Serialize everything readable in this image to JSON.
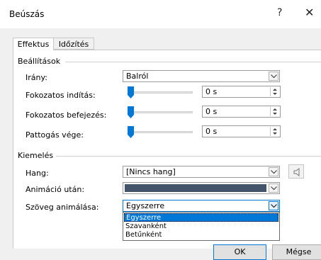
{
  "dialog": {
    "title": "Beúszás",
    "help_glyph": "?",
    "close_glyph": "✕"
  },
  "tabs": [
    {
      "label": "Effektus",
      "active": true
    },
    {
      "label": "Időzítés",
      "active": false
    }
  ],
  "settings": {
    "group_label": "Beállítások",
    "direction_label": "Irány:",
    "direction_value": "Balról",
    "smooth_start_label": "Fokozatos indítás:",
    "smooth_start_value": "0 s",
    "smooth_end_label": "Fokozatos befejezés:",
    "smooth_end_value": "0 s",
    "bounce_end_label": "Pattogás vége:",
    "bounce_end_value": "0 s",
    "slider_levels": [
      0,
      0,
      0
    ]
  },
  "enhancements": {
    "group_label": "Kiemelés",
    "sound_label": "Hang:",
    "sound_value": "[Nincs hang]",
    "after_animation_label": "Animáció után:",
    "after_animation_color": "#44546a",
    "animate_text_label": "Szöveg animálása:",
    "animate_text_value": "Egyszerre",
    "animate_text_options": [
      "Egyszerre",
      "Szavanként",
      "Betűnként"
    ],
    "selected_option_index": 0
  },
  "buttons": {
    "ok": "OK",
    "cancel": "Mégse"
  },
  "colors": {
    "accent": "#0078d7",
    "slider_thumb": "#0078d7"
  }
}
